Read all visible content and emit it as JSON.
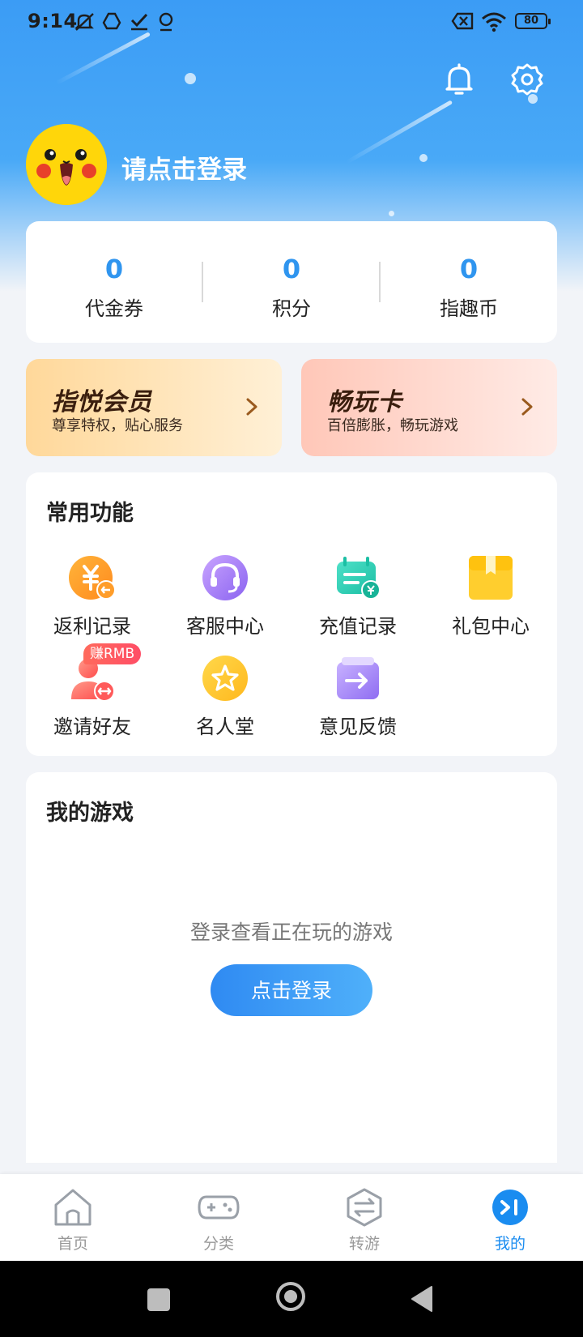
{
  "status_bar": {
    "time": "9:14",
    "battery": "80",
    "icons": [
      "muted-icon",
      "drive-icon",
      "check-icon",
      "location-icon",
      "no-sim-icon",
      "wifi-icon",
      "battery-icon"
    ]
  },
  "header": {
    "icons": [
      "bell-icon",
      "gear-icon"
    ]
  },
  "profile": {
    "login_prompt": "请点击登录",
    "avatar_icon": "pikachu-avatar"
  },
  "stats": [
    {
      "value": "0",
      "label": "代金券"
    },
    {
      "value": "0",
      "label": "积分"
    },
    {
      "value": "0",
      "label": "指趣币"
    }
  ],
  "promos": [
    {
      "title": "指悦会员",
      "subtitle": "尊享特权，贴心服务",
      "icon": "chevron-right-icon"
    },
    {
      "title": "畅玩卡",
      "subtitle": "百倍膨胀，畅玩游戏",
      "icon": "chevron-right-icon"
    }
  ],
  "common_functions": {
    "title": "常用功能",
    "items": [
      {
        "label": "返利记录",
        "icon": "rebate-icon"
      },
      {
        "label": "客服中心",
        "icon": "headset-icon"
      },
      {
        "label": "充值记录",
        "icon": "recharge-icon"
      },
      {
        "label": "礼包中心",
        "icon": "gift-box-icon"
      },
      {
        "label": "邀请好友",
        "icon": "invite-user-icon",
        "badge": "赚RMB"
      },
      {
        "label": "名人堂",
        "icon": "star-icon"
      },
      {
        "label": "意见反馈",
        "icon": "feedback-icon"
      }
    ]
  },
  "my_games": {
    "title": "我的游戏",
    "empty_text": "登录查看正在玩的游戏",
    "login_button": "点击登录"
  },
  "tabs": [
    {
      "label": "首页",
      "icon": "home-icon",
      "active": false
    },
    {
      "label": "分类",
      "icon": "gamepad-icon",
      "active": false
    },
    {
      "label": "转游",
      "icon": "transfer-icon",
      "active": false
    },
    {
      "label": "我的",
      "icon": "profile-logo-icon",
      "active": true
    }
  ],
  "colors": {
    "accent": "#2f95ef",
    "active_tab": "#1a8cf0",
    "hero_top": "#3b9cf5",
    "vip_gradient": [
      "#ffd89a",
      "#fff0d6"
    ],
    "play_card_gradient": [
      "#ffc7b8",
      "#ffebe6"
    ]
  }
}
